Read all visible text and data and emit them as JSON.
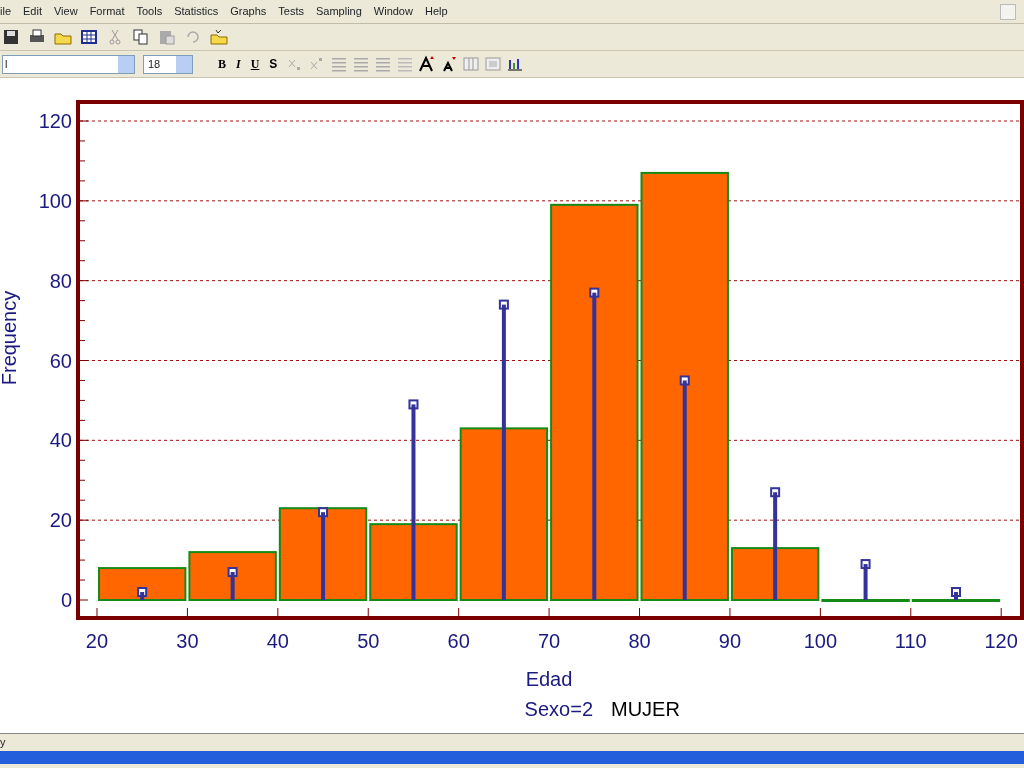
{
  "menu": [
    "ile",
    "Edit",
    "View",
    "Format",
    "Tools",
    "Statistics",
    "Graphs",
    "Tests",
    "Sampling",
    "Window",
    "Help"
  ],
  "font_field": {
    "value": "l"
  },
  "size_field": {
    "value": "18"
  },
  "format_buttons": [
    "B",
    "I",
    "U",
    "S"
  ],
  "chart": {
    "chart_data": {
      "type": "bar",
      "xlabel": "Edad",
      "ylabel": "Frequency",
      "x": [
        25,
        35,
        45,
        55,
        65,
        75,
        85,
        95,
        105,
        115
      ],
      "series": [
        {
          "color": "#ff6600",
          "values": [
            8,
            12,
            23,
            19,
            43,
            99,
            107,
            13,
            0,
            0
          ]
        },
        {
          "color": "#333399",
          "values": [
            2,
            7,
            22,
            49,
            74,
            77,
            55,
            27,
            9,
            2
          ]
        }
      ],
      "xlim": [
        17.9,
        122.3
      ],
      "grid": true,
      "ylim": [
        0,
        120
      ],
      "xticks": [
        20,
        30,
        40,
        50,
        60,
        70,
        80,
        90,
        100,
        110,
        120
      ],
      "yticks": [
        0,
        20,
        40,
        60,
        80,
        100,
        120
      ]
    },
    "subtitle": "Sexo=2",
    "group_label": "MUJER"
  },
  "status_bar": "y"
}
